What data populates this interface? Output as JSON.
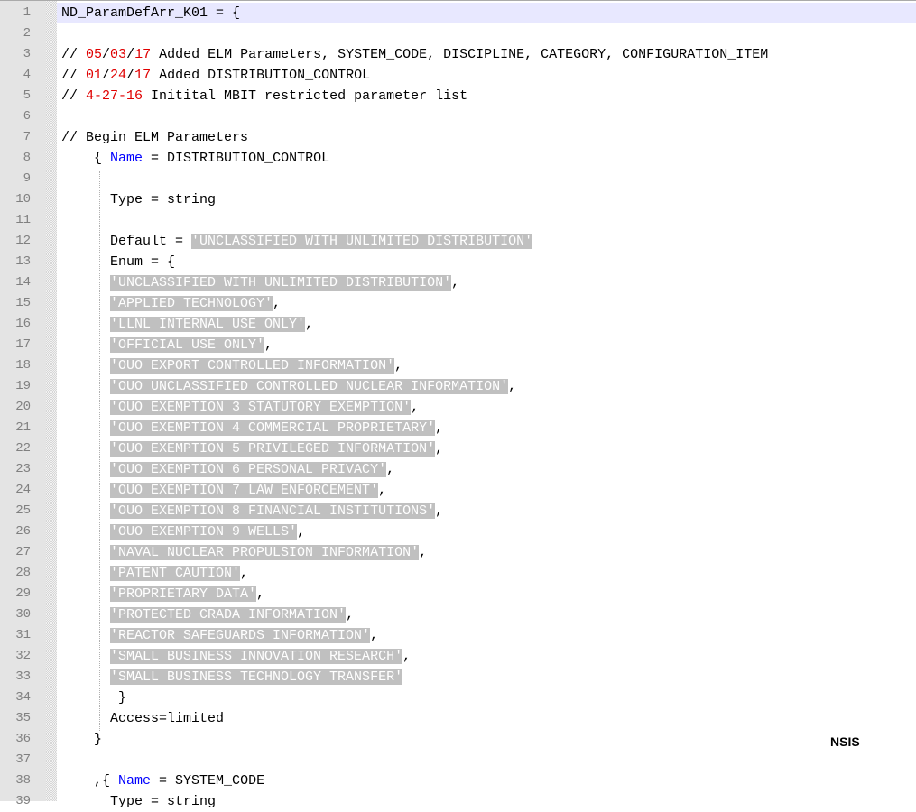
{
  "language_label": "NSIS",
  "lines": [
    {
      "n": "1",
      "indent": "",
      "segments": [
        {
          "t": "ND_ParamDefArr_K01 = {",
          "s": "c"
        }
      ]
    },
    {
      "n": "2",
      "indent": "",
      "segments": []
    },
    {
      "n": "3",
      "indent": "",
      "segments": [
        {
          "t": "// ",
          "s": "c"
        },
        {
          "t": "05",
          "s": "red"
        },
        {
          "t": "/",
          "s": "c"
        },
        {
          "t": "03",
          "s": "red"
        },
        {
          "t": "/",
          "s": "c"
        },
        {
          "t": "17",
          "s": "red"
        },
        {
          "t": " Added ELM Parameters, SYSTEM_CODE, DISCIPLINE, CATEGORY, CONFIGURATION_ITEM",
          "s": "c"
        }
      ]
    },
    {
      "n": "4",
      "indent": "",
      "segments": [
        {
          "t": "// ",
          "s": "c"
        },
        {
          "t": "01",
          "s": "red"
        },
        {
          "t": "/",
          "s": "c"
        },
        {
          "t": "24",
          "s": "red"
        },
        {
          "t": "/",
          "s": "c"
        },
        {
          "t": "17",
          "s": "red"
        },
        {
          "t": " Added DISTRIBUTION_CONTROL",
          "s": "c"
        }
      ]
    },
    {
      "n": "5",
      "indent": "",
      "segments": [
        {
          "t": "// ",
          "s": "c"
        },
        {
          "t": "4-27-16",
          "s": "red"
        },
        {
          "t": " Initital MBIT restricted parameter list",
          "s": "c"
        }
      ]
    },
    {
      "n": "6",
      "indent": "",
      "segments": []
    },
    {
      "n": "7",
      "indent": "",
      "segments": [
        {
          "t": "// Begin ELM Parameters",
          "s": "c"
        }
      ]
    },
    {
      "n": "8",
      "indent": "    ",
      "segments": [
        {
          "t": "{ ",
          "s": "c"
        },
        {
          "t": "Name",
          "s": "blue"
        },
        {
          "t": " = DISTRIBUTION_CONTROL",
          "s": "c"
        }
      ]
    },
    {
      "n": "9",
      "indent": "",
      "segments": []
    },
    {
      "n": "10",
      "indent": "      ",
      "segments": [
        {
          "t": "Type = string",
          "s": "c"
        }
      ]
    },
    {
      "n": "11",
      "indent": "",
      "segments": []
    },
    {
      "n": "12",
      "indent": "      ",
      "segments": [
        {
          "t": "Default = ",
          "s": "c"
        },
        {
          "t": "'UNCLASSIFIED WITH UNLIMITED DISTRIBUTION'",
          "s": "sel"
        }
      ]
    },
    {
      "n": "13",
      "indent": "      ",
      "segments": [
        {
          "t": "Enum = {",
          "s": "c"
        }
      ]
    },
    {
      "n": "14",
      "indent": "      ",
      "segments": [
        {
          "t": "'UNCLASSIFIED WITH UNLIMITED DISTRIBUTION'",
          "s": "sel"
        },
        {
          "t": ",",
          "s": "c"
        }
      ]
    },
    {
      "n": "15",
      "indent": "      ",
      "segments": [
        {
          "t": "'APPLIED TECHNOLOGY'",
          "s": "sel"
        },
        {
          "t": ",",
          "s": "c"
        }
      ]
    },
    {
      "n": "16",
      "indent": "      ",
      "segments": [
        {
          "t": "'LLNL INTERNAL USE ONLY'",
          "s": "sel"
        },
        {
          "t": ",",
          "s": "c"
        }
      ]
    },
    {
      "n": "17",
      "indent": "      ",
      "segments": [
        {
          "t": "'OFFICIAL USE ONLY'",
          "s": "sel"
        },
        {
          "t": ",",
          "s": "c"
        }
      ]
    },
    {
      "n": "18",
      "indent": "      ",
      "segments": [
        {
          "t": "'OUO EXPORT CONTROLLED INFORMATION'",
          "s": "sel"
        },
        {
          "t": ",",
          "s": "c"
        }
      ]
    },
    {
      "n": "19",
      "indent": "      ",
      "segments": [
        {
          "t": "'OUO UNCLASSIFIED CONTROLLED NUCLEAR INFORMATION'",
          "s": "sel"
        },
        {
          "t": ",",
          "s": "c"
        }
      ]
    },
    {
      "n": "20",
      "indent": "      ",
      "segments": [
        {
          "t": "'OUO EXEMPTION 3 STATUTORY EXEMPTION'",
          "s": "sel"
        },
        {
          "t": ",",
          "s": "c"
        }
      ]
    },
    {
      "n": "21",
      "indent": "      ",
      "segments": [
        {
          "t": "'OUO EXEMPTION 4 COMMERCIAL PROPRIETARY'",
          "s": "sel"
        },
        {
          "t": ",",
          "s": "c"
        }
      ]
    },
    {
      "n": "22",
      "indent": "      ",
      "segments": [
        {
          "t": "'OUO EXEMPTION 5 PRIVILEGED INFORMATION'",
          "s": "sel"
        },
        {
          "t": ",",
          "s": "c"
        }
      ]
    },
    {
      "n": "23",
      "indent": "      ",
      "segments": [
        {
          "t": "'OUO EXEMPTION 6 PERSONAL PRIVACY'",
          "s": "sel"
        },
        {
          "t": ",",
          "s": "c"
        }
      ]
    },
    {
      "n": "24",
      "indent": "      ",
      "segments": [
        {
          "t": "'OUO EXEMPTION 7 LAW ENFORCEMENT'",
          "s": "sel"
        },
        {
          "t": ",",
          "s": "c"
        }
      ]
    },
    {
      "n": "25",
      "indent": "      ",
      "segments": [
        {
          "t": "'OUO EXEMPTION 8 FINANCIAL INSTITUTIONS'",
          "s": "sel"
        },
        {
          "t": ",",
          "s": "c"
        }
      ]
    },
    {
      "n": "26",
      "indent": "      ",
      "segments": [
        {
          "t": "'OUO EXEMPTION 9 WELLS'",
          "s": "sel"
        },
        {
          "t": ",",
          "s": "c"
        }
      ]
    },
    {
      "n": "27",
      "indent": "      ",
      "segments": [
        {
          "t": "'NAVAL NUCLEAR PROPULSION INFORMATION'",
          "s": "sel"
        },
        {
          "t": ",",
          "s": "c"
        }
      ]
    },
    {
      "n": "28",
      "indent": "      ",
      "segments": [
        {
          "t": "'PATENT CAUTION'",
          "s": "sel"
        },
        {
          "t": ",",
          "s": "c"
        }
      ]
    },
    {
      "n": "29",
      "indent": "      ",
      "segments": [
        {
          "t": "'PROPRIETARY DATA'",
          "s": "sel"
        },
        {
          "t": ",",
          "s": "c"
        }
      ]
    },
    {
      "n": "30",
      "indent": "      ",
      "segments": [
        {
          "t": "'PROTECTED CRADA INFORMATION'",
          "s": "sel"
        },
        {
          "t": ",",
          "s": "c"
        }
      ]
    },
    {
      "n": "31",
      "indent": "      ",
      "segments": [
        {
          "t": "'REACTOR SAFEGUARDS INFORMATION'",
          "s": "sel"
        },
        {
          "t": ",",
          "s": "c"
        }
      ]
    },
    {
      "n": "32",
      "indent": "      ",
      "segments": [
        {
          "t": "'SMALL BUSINESS INNOVATION RESEARCH'",
          "s": "sel"
        },
        {
          "t": ",",
          "s": "c"
        }
      ]
    },
    {
      "n": "33",
      "indent": "      ",
      "segments": [
        {
          "t": "'SMALL BUSINESS TECHNOLOGY TRANSFER'",
          "s": "sel"
        }
      ]
    },
    {
      "n": "34",
      "indent": "       ",
      "segments": [
        {
          "t": "}",
          "s": "c"
        }
      ]
    },
    {
      "n": "35",
      "indent": "      ",
      "segments": [
        {
          "t": "Access=limited",
          "s": "c"
        }
      ]
    },
    {
      "n": "36",
      "indent": "    ",
      "segments": [
        {
          "t": "}",
          "s": "c"
        }
      ]
    },
    {
      "n": "37",
      "indent": "",
      "segments": []
    },
    {
      "n": "38",
      "indent": "    ",
      "segments": [
        {
          "t": ",{ ",
          "s": "c"
        },
        {
          "t": "Name",
          "s": "blue"
        },
        {
          "t": " = SYSTEM_CODE",
          "s": "c"
        }
      ]
    },
    {
      "n": "39",
      "indent": "      ",
      "segments": [
        {
          "t": "Type = string",
          "s": "c"
        }
      ]
    }
  ],
  "current_line": "1",
  "colors": {
    "gutter_bg": "#e4e4e4",
    "line_number": "#808080",
    "number_literal": "#e00000",
    "keyword": "#0000ff",
    "selection_bg": "#c0c0c0",
    "selection_fg": "#ffffff",
    "current_line_bg": "#e8e8ff"
  }
}
